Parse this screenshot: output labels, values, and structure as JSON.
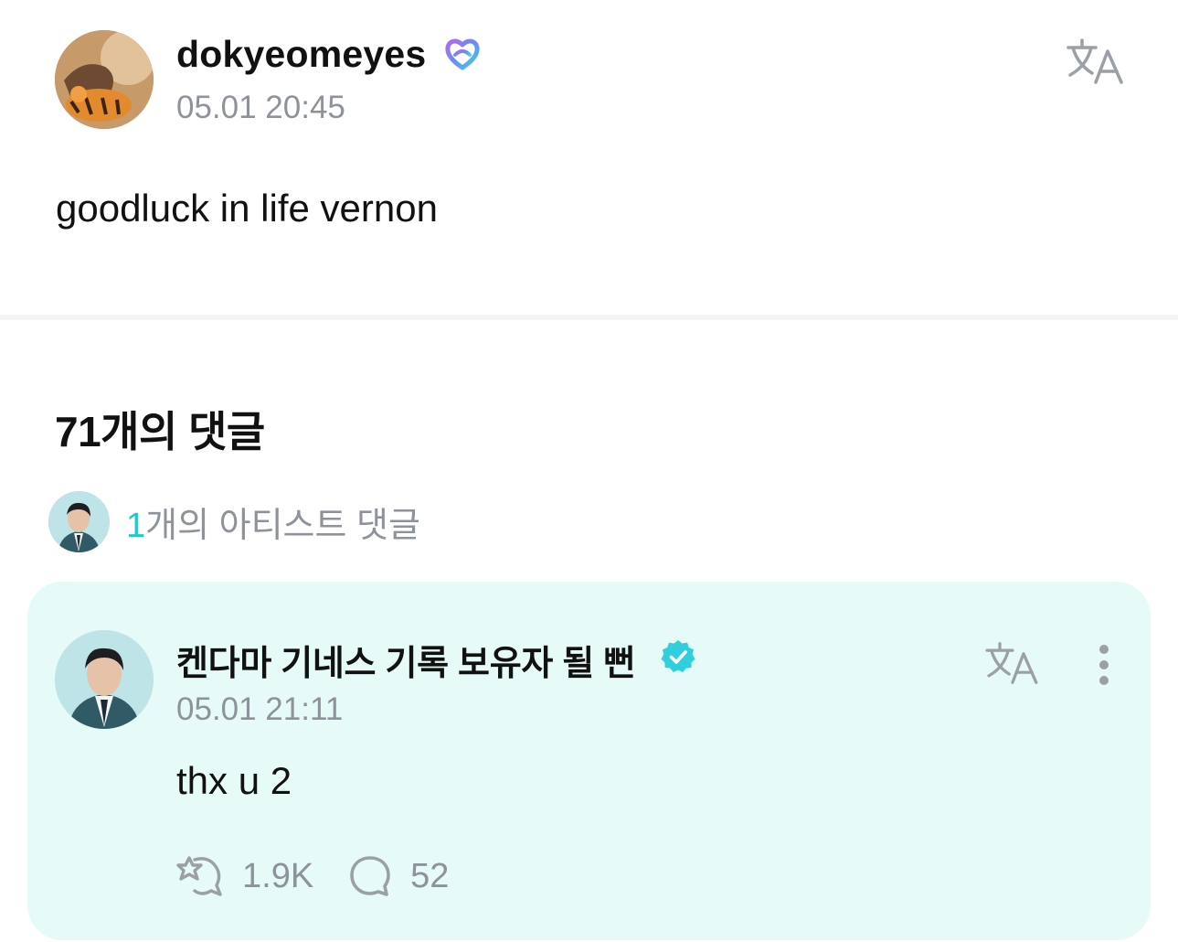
{
  "post": {
    "author": {
      "name": "dokyeomeyes",
      "badge_icon": "membership-heart-icon"
    },
    "timestamp": "05.01 20:45",
    "body": "goodluck in life vernon",
    "translate_icon": "translate-icon"
  },
  "comments": {
    "count_heading": "71개의 댓글",
    "artist_comments": {
      "count": "1",
      "label": "개의 아티스트 댓글"
    },
    "items": [
      {
        "author": {
          "name": "켄다마 기네스 기록 보유자 될 뻔",
          "badge_icon": "verified-icon"
        },
        "timestamp": "05.01 21:11",
        "body": "thx u 2",
        "likes": "1.9K",
        "replies": "52",
        "translate_icon": "translate-icon",
        "more_icon": "more-vertical-icon"
      }
    ]
  },
  "colors": {
    "accent": "#23c7cf",
    "card_background": "#e6fbf7",
    "muted_text": "#8e939b",
    "icon_gray": "#9aa0a6"
  }
}
